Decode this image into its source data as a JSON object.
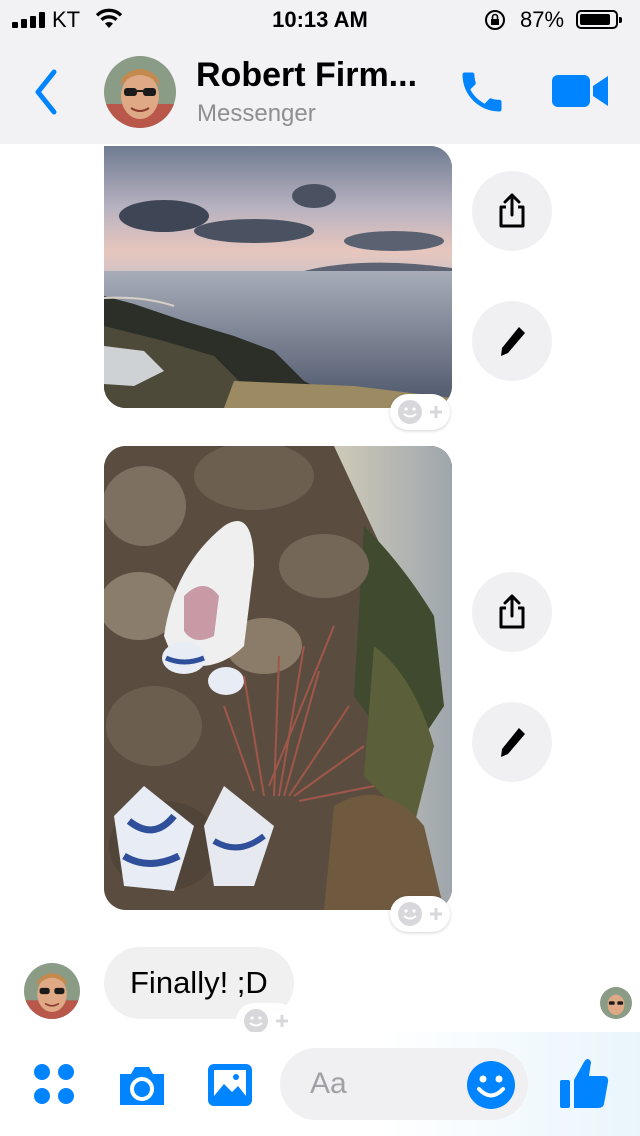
{
  "status_bar": {
    "carrier": "KT",
    "time": "10:13 AM",
    "battery_percent": "87%",
    "battery_level": 0.87
  },
  "header": {
    "name": "Robert Firm...",
    "subtitle": "Messenger"
  },
  "messages": [
    {
      "text": "Finally! ;D"
    }
  ],
  "composer": {
    "placeholder": "Aa"
  },
  "colors": {
    "accent": "#0084ff",
    "bubble": "#f1f0f0",
    "header_bg": "#f2f2f4"
  },
  "icons": [
    "back-icon",
    "phone-icon",
    "video-camera-icon",
    "share-icon",
    "pencil-icon",
    "add-reaction-icon",
    "apps-icon",
    "camera-icon",
    "gallery-icon",
    "emoji-icon",
    "thumbs-up-icon",
    "lock-rotation-icon",
    "wifi-icon"
  ]
}
